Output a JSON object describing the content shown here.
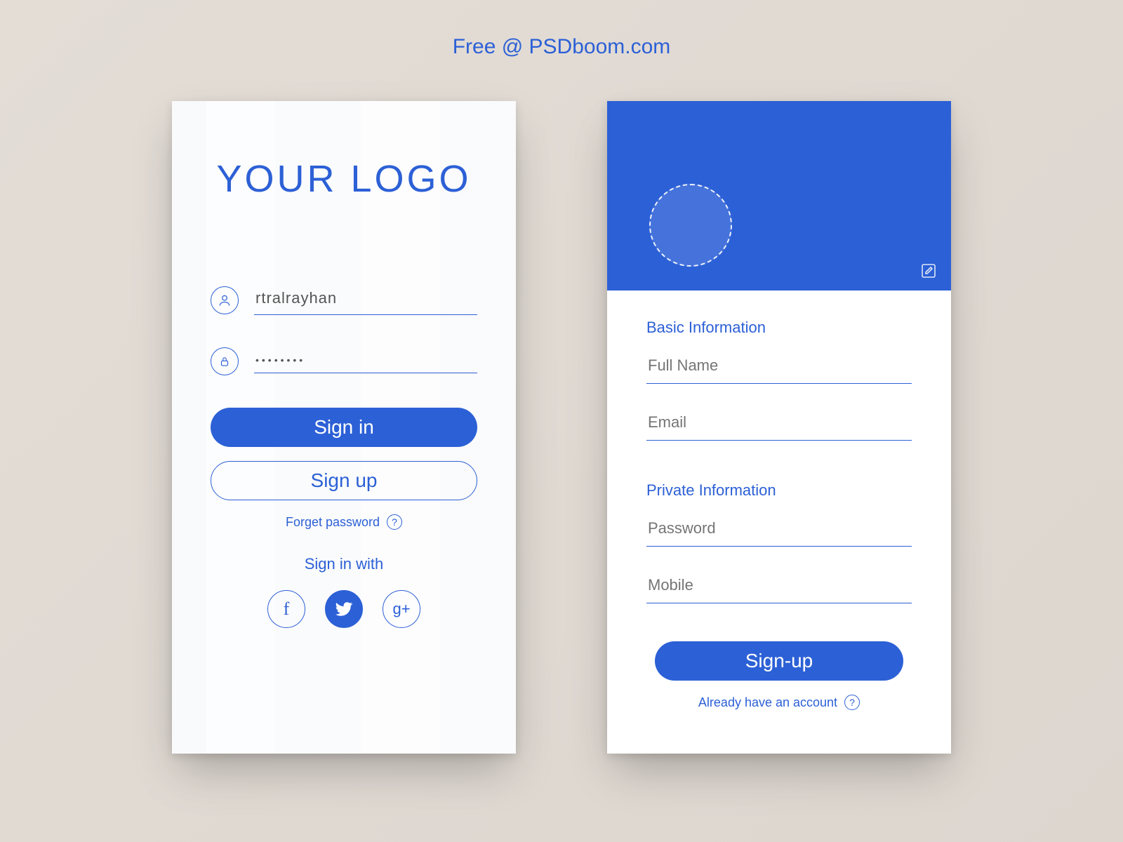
{
  "header": {
    "tagline": "Free @ PSDboom.com"
  },
  "login": {
    "logo": "YOUR LOGO",
    "username_value": "rtralrayhan",
    "password_value": "••••••••",
    "signin_label": "Sign in",
    "signup_label": "Sign up",
    "forgot_label": "Forget password",
    "signin_with_label": "Sign in with",
    "social": {
      "facebook": "f",
      "twitter": "",
      "google": "g+"
    }
  },
  "signup": {
    "section_basic": "Basic Information",
    "fullname_placeholder": "Full Name",
    "email_placeholder": "Email",
    "section_private": "Private Information",
    "password_placeholder": "Password",
    "mobile_placeholder": "Mobile",
    "submit_label": "Sign-up",
    "already_label": "Already have an account"
  },
  "colors": {
    "accent": "#2c60d6"
  }
}
